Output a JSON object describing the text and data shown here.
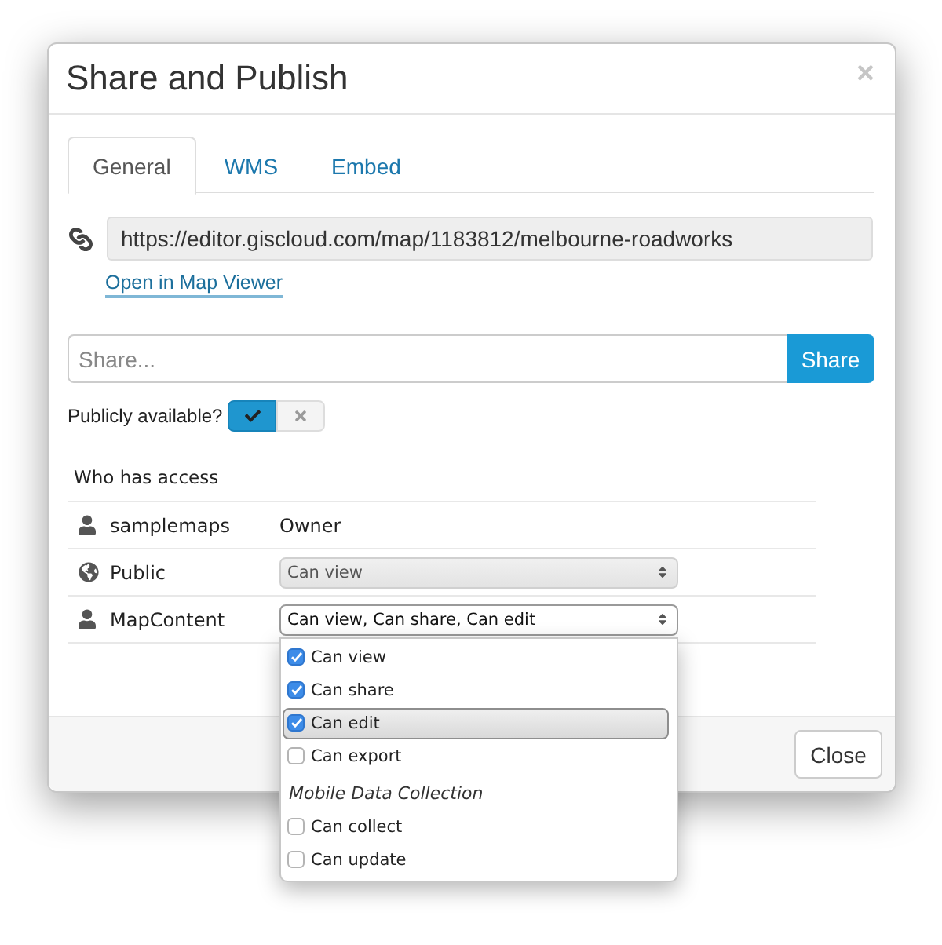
{
  "dialog": {
    "title": "Share and Publish",
    "close_glyph": "×"
  },
  "tabs": [
    {
      "label": "General",
      "selected": true
    },
    {
      "label": "WMS",
      "selected": false
    },
    {
      "label": "Embed",
      "selected": false
    }
  ],
  "link": {
    "url": "https://editor.giscloud.com/map/1183812/melbourne-roadworks",
    "viewer_link": "Open in Map Viewer"
  },
  "share": {
    "placeholder": "Share...",
    "button": "Share"
  },
  "public_toggle": {
    "label": "Publicly available?",
    "on": true
  },
  "access": {
    "heading": "Who has access",
    "rows": [
      {
        "kind": "user",
        "name": "samplemaps",
        "permission": {
          "kind": "text",
          "value": "Owner"
        }
      },
      {
        "kind": "public",
        "name": "Public",
        "permission": {
          "kind": "select",
          "value": "Can view",
          "disabled": true
        }
      },
      {
        "kind": "user",
        "name": "MapContent",
        "permission": {
          "kind": "select",
          "value": "Can view, Can share, Can edit",
          "disabled": false,
          "options": [
            {
              "kind": "option",
              "label": "Can view",
              "checked": true,
              "highlighted": false
            },
            {
              "kind": "option",
              "label": "Can share",
              "checked": true,
              "highlighted": false
            },
            {
              "kind": "option",
              "label": "Can edit",
              "checked": true,
              "highlighted": true
            },
            {
              "kind": "option",
              "label": "Can export",
              "checked": false,
              "highlighted": false
            },
            {
              "kind": "group",
              "label": "Mobile Data Collection"
            },
            {
              "kind": "option",
              "label": "Can collect",
              "checked": false,
              "highlighted": false
            },
            {
              "kind": "option",
              "label": "Can update",
              "checked": false,
              "highlighted": false
            }
          ]
        }
      }
    ]
  },
  "footer": {
    "close_button": "Close"
  }
}
